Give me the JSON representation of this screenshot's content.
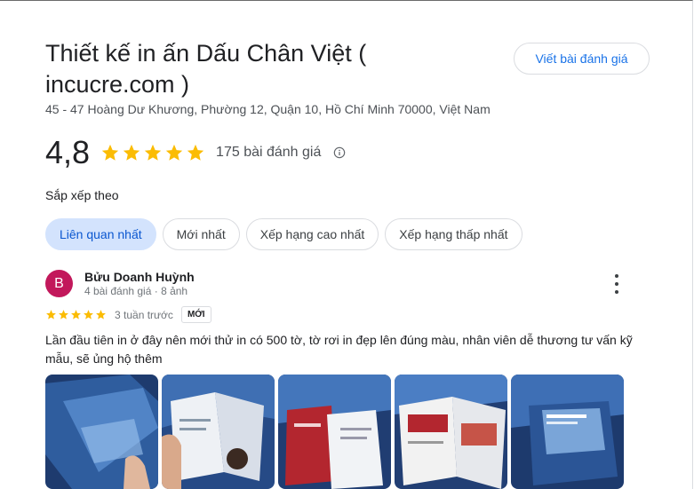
{
  "place": {
    "title": "Thiết kế in ấn Dấu Chân Việt ( incucre.com )",
    "address": "45 - 47 Hoàng Dư Khương, Phường 12, Quận 10, Hồ Chí Minh 70000, Việt Nam",
    "rating": "4,8",
    "review_count": "175 bài đánh giá",
    "write_review_label": "Viết bài đánh giá",
    "star_color": "#fbbc04"
  },
  "sort": {
    "label": "Sắp xếp theo",
    "options": [
      "Liên quan nhất",
      "Mới nhất",
      "Xếp hạng cao nhất",
      "Xếp hạng thấp nhất"
    ],
    "selected": "Liên quan nhất"
  },
  "review": {
    "avatar_letter": "B",
    "avatar_color": "#c2185b",
    "name": "Bửu Doanh Huỳnh",
    "meta": "4 bài đánh giá · 8 ảnh",
    "stars": 5,
    "time": "3 tuần trước",
    "badge": "MỚI",
    "text": "Lần đầu tiên in ở đây nên mới thử in có 500 tờ, tờ rơi in đẹp lên đúng màu, nhân viên dễ thương tư vấn kỹ mẫu, sẽ ủng hộ thêm",
    "photo_count": 5
  }
}
